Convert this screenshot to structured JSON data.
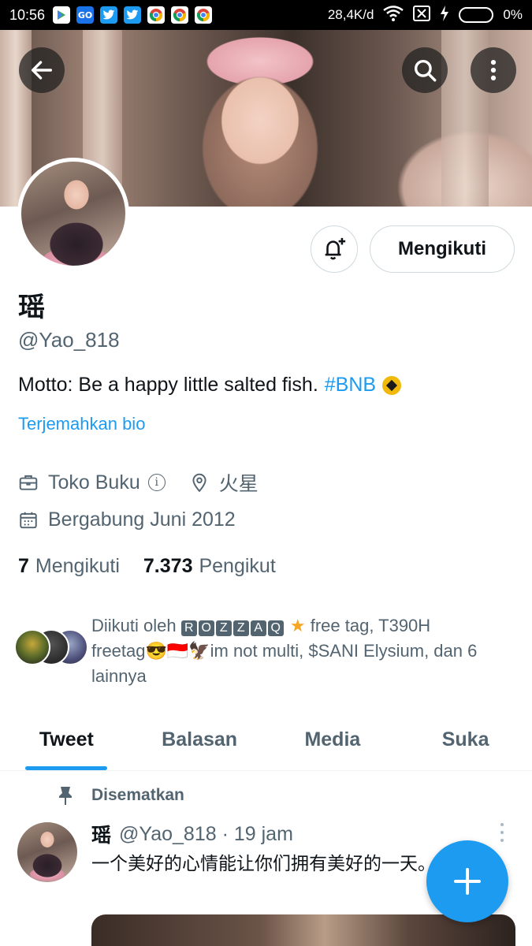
{
  "status_bar": {
    "time": "10:56",
    "network_speed": "28,4K/d",
    "battery": "0%",
    "app_icons": [
      "play-store-icon",
      "go-icon",
      "twitter-icon",
      "twitter-icon",
      "chrome-icon",
      "chrome-icon",
      "chrome-icon"
    ]
  },
  "profile": {
    "name": "瑶",
    "handle": "@Yao_818",
    "bio_text": "Motto: Be a happy little salted fish.",
    "bio_hashtag": "#BNB",
    "translate_link": "Terjemahkan bio",
    "category": "Toko Buku",
    "location": "火星",
    "joined": "Bergabung Juni 2012",
    "following_count": "7",
    "following_label": "Mengikuti",
    "followers_count": "7.373",
    "followers_label": "Pengikut",
    "followed_by_prefix": "Diikuti oleh",
    "followed_by_boxed": [
      "R",
      "O",
      "Z",
      "Z",
      "A",
      "Q"
    ],
    "followed_by_rest_1": "free tag, T390H",
    "followed_by_rest_2": "freetag😎🇮🇩🦅im not multi, $SANI Elysium, dan 6",
    "followed_by_rest_3": "lainnya"
  },
  "actions": {
    "follow_button": "Mengikuti"
  },
  "tabs": [
    "Tweet",
    "Balasan",
    "Media",
    "Suka"
  ],
  "pinned_tweet": {
    "label": "Disematkan",
    "name": "瑶",
    "meta": "@Yao_818 · 19 jam",
    "text": "一个美好的心情能让你们拥有美好的一天。"
  },
  "colors": {
    "accent": "#1d9bf0",
    "text_primary": "#0f1419",
    "text_secondary": "#536471"
  }
}
